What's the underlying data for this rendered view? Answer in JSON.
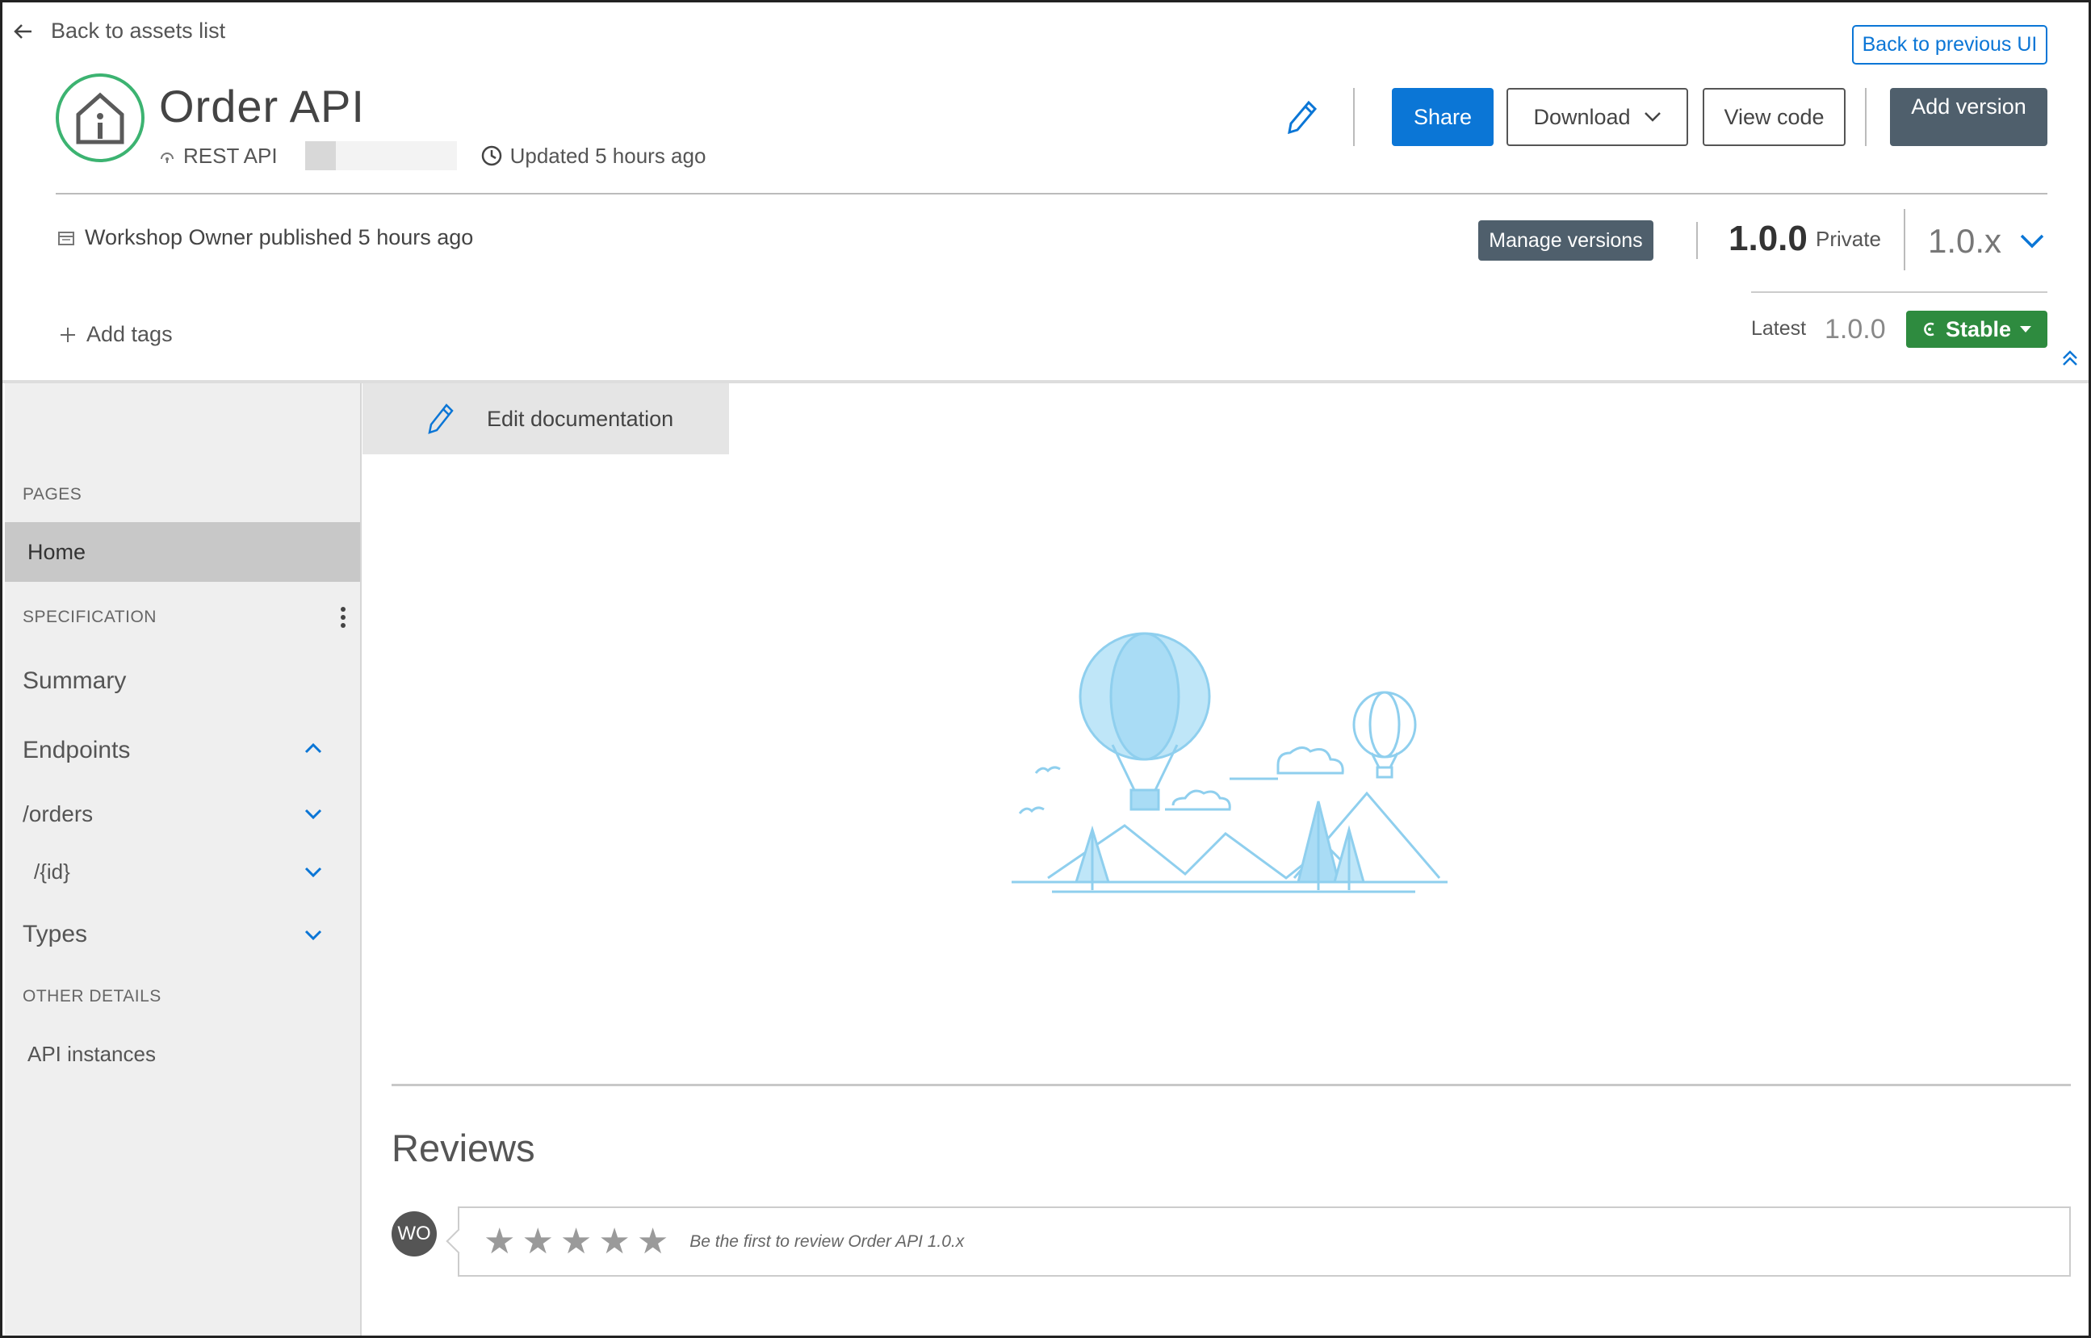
{
  "header": {
    "back_link": "Back to assets list",
    "back_previous": "Back to previous UI",
    "title": "Order API",
    "api_type": "REST API",
    "updated": "Updated 5 hours ago",
    "published": "Workshop Owner published 5 hours ago",
    "add_tags": "Add tags"
  },
  "toolbar": {
    "share": "Share",
    "download": "Download",
    "view_code": "View code",
    "add_version": "Add version",
    "manage_versions": "Manage versions"
  },
  "version": {
    "current": "1.0.0",
    "visibility": "Private",
    "selected": "1.0.x",
    "latest_label": "Latest",
    "latest_value": "1.0.0",
    "state": "Stable"
  },
  "sidebar": {
    "pages_heading": "PAGES",
    "home": "Home",
    "spec_heading": "SPECIFICATION",
    "summary": "Summary",
    "endpoints": "Endpoints",
    "orders": "/orders",
    "id": "/{id}",
    "types": "Types",
    "other_heading": "OTHER DETAILS",
    "api_instances": "API instances"
  },
  "main": {
    "edit_documentation": "Edit documentation",
    "reviews_title": "Reviews",
    "reviewer_initials": "WO",
    "review_prompt": "Be the first to review Order API 1.0.x",
    "rating_max": 5
  },
  "colors": {
    "primary": "#0b76d6",
    "stable": "#2e8b3f",
    "dark_button": "#4f5f6c",
    "logo_ring": "#3cb371",
    "illustration": "#a9dcf5"
  }
}
